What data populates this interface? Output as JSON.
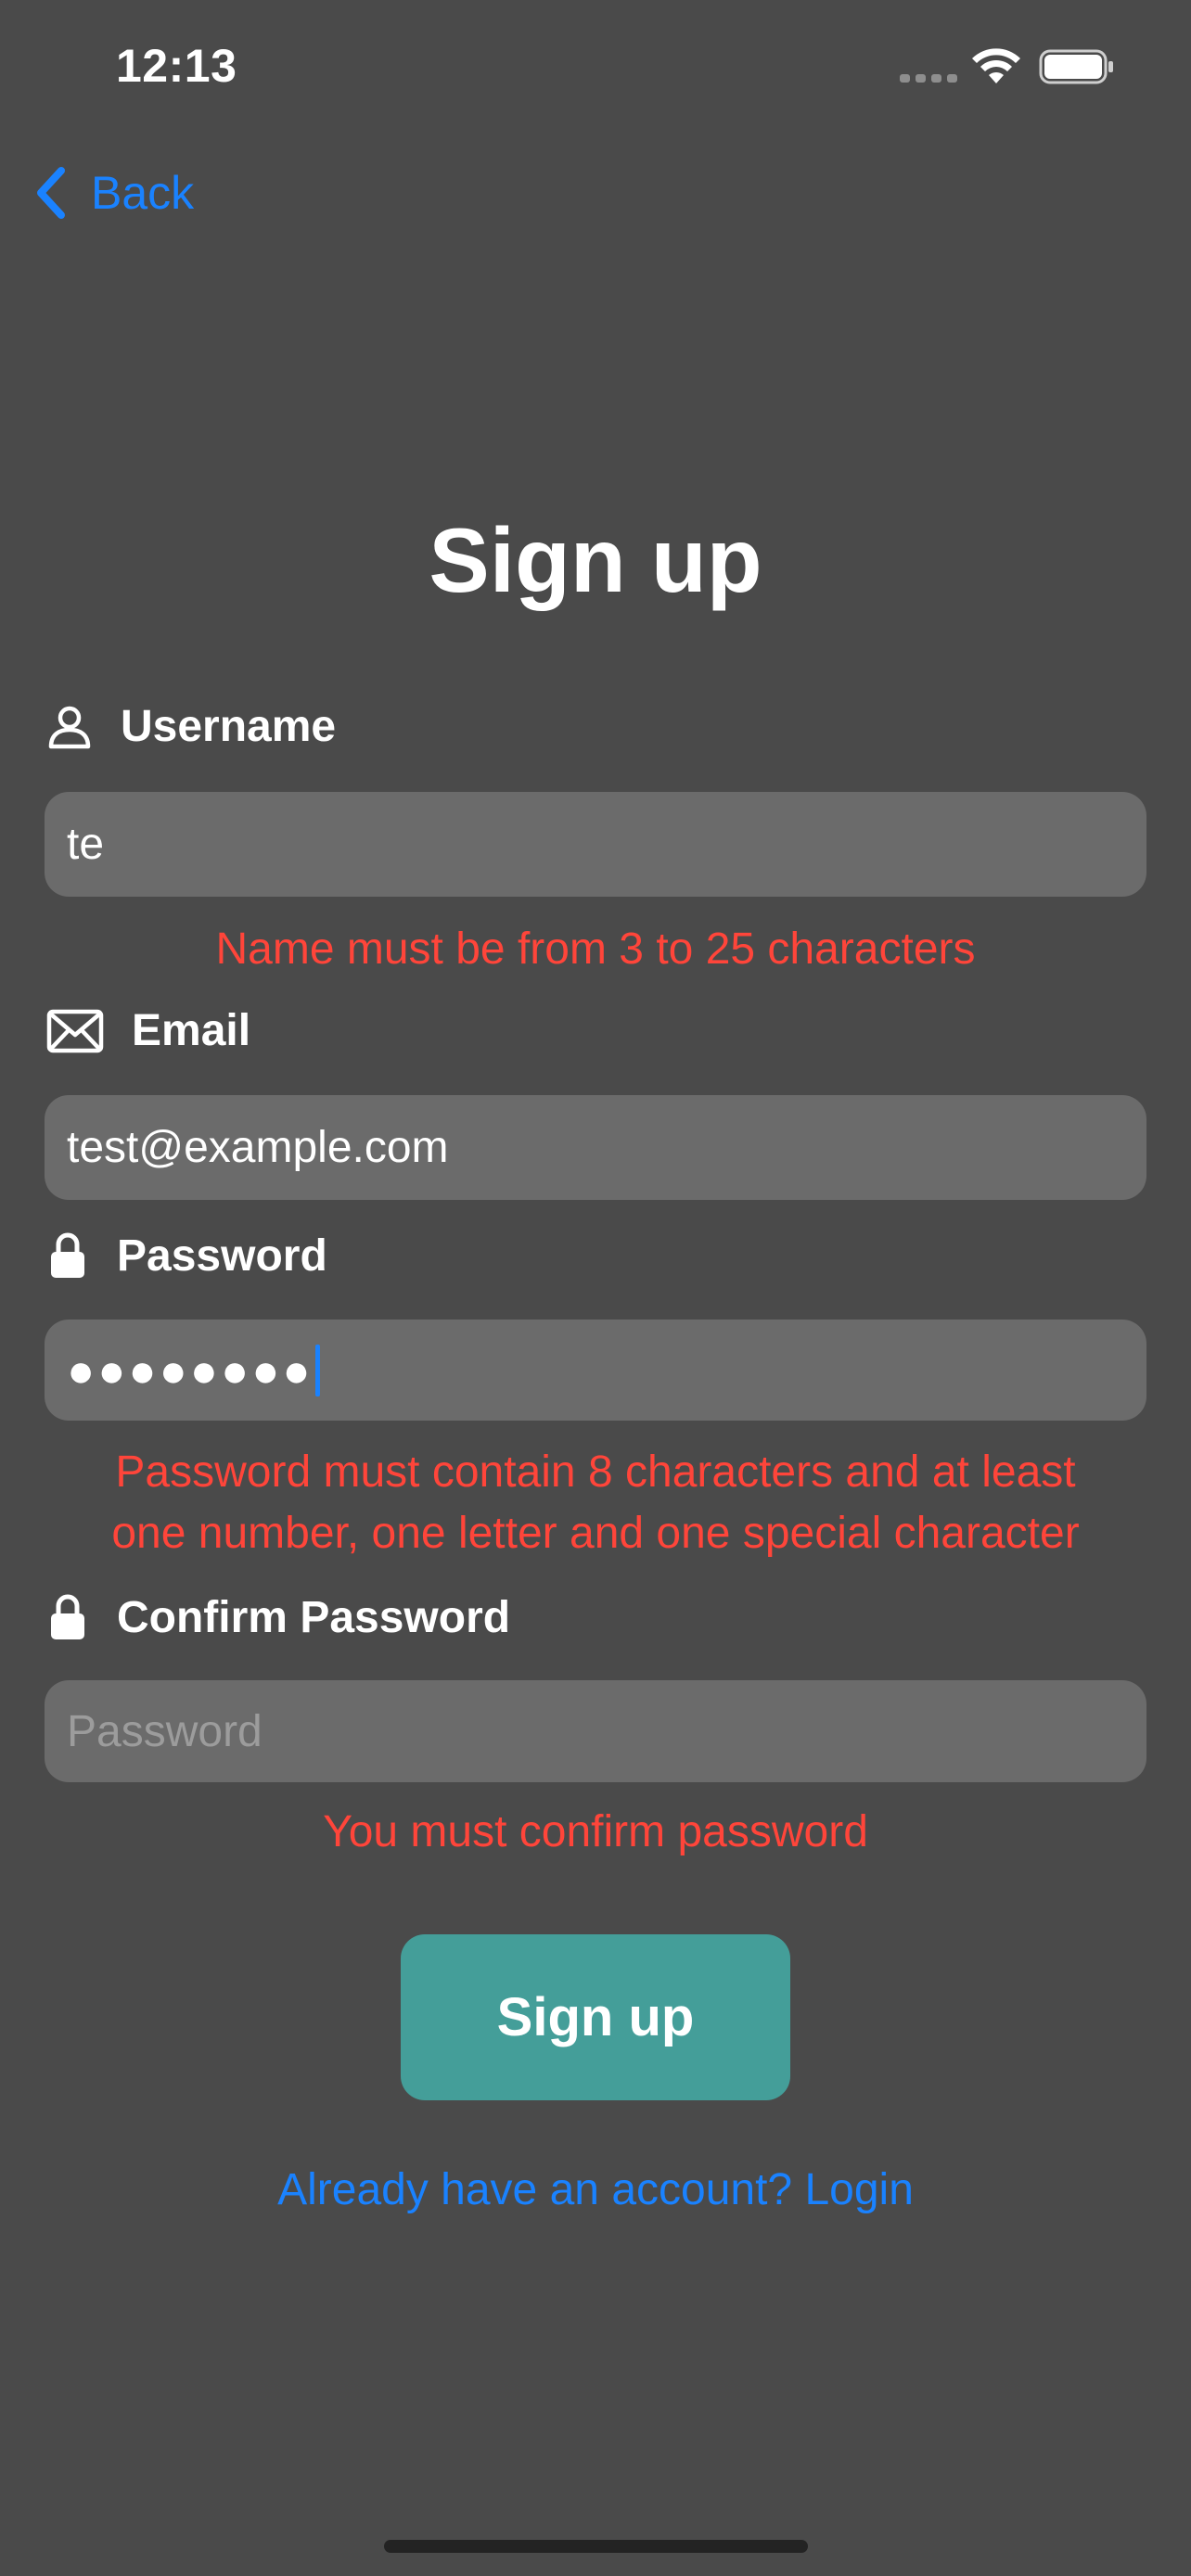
{
  "status_bar": {
    "time": "12:13"
  },
  "nav": {
    "back_label": "Back"
  },
  "title": "Sign up",
  "form": {
    "username": {
      "label": "Username",
      "value": "te",
      "icon": "person-icon",
      "error": "Name must be from 3 to 25 characters"
    },
    "email": {
      "label": "Email",
      "value": "test@example.com",
      "icon": "envelope-icon"
    },
    "password": {
      "label": "Password",
      "masked_value": "●●●●●●●●",
      "icon": "lock-icon",
      "error_line1": "Password must contain 8 characters and at least",
      "error_line2": "one number, one letter and one special character"
    },
    "confirm_password": {
      "label": "Confirm Password",
      "placeholder": "Password",
      "icon": "lock-icon",
      "error": "You must confirm password"
    }
  },
  "actions": {
    "signup_label": "Sign up",
    "login_link": "Already have an account? Login"
  },
  "colors": {
    "background": "#4a4a4a",
    "field_background": "#6b6b6b",
    "accent_blue": "#1a82ff",
    "error_red": "#ff453a",
    "button_teal": "#449e99"
  }
}
